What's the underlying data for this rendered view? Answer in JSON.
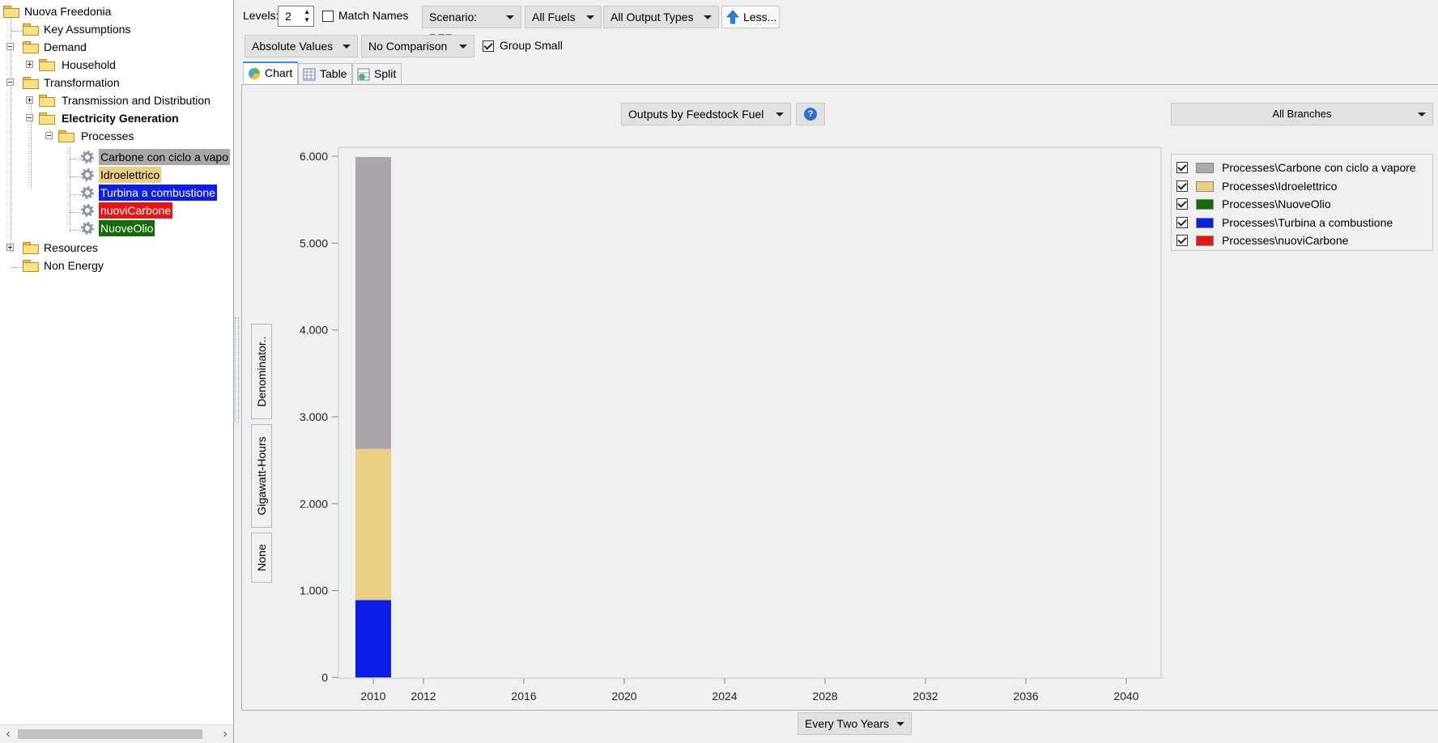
{
  "tree": {
    "root": "Nuova Freedonia",
    "key_assumptions": "Key Assumptions",
    "demand": "Demand",
    "household": "Household",
    "transformation": "Transformation",
    "transmission": "Transmission and Distribution",
    "electricity_generation": "Electricity Generation",
    "processes": "Processes",
    "process_items": [
      {
        "label": "Carbone con ciclo a vapo",
        "bg": "#a8a8a8",
        "fg": "#000000"
      },
      {
        "label": "Idroelettrico",
        "bg": "#e8cf83",
        "fg": "#000000"
      },
      {
        "label": "Turbina a combustione",
        "bg": "#0a1ee6",
        "fg": "#ffffff"
      },
      {
        "label": "nuoviCarbone",
        "bg": "#e61616",
        "fg": "#ffffff"
      },
      {
        "label": "NuoveOlio",
        "bg": "#166a0c",
        "fg": "#ffffff"
      }
    ],
    "resources": "Resources",
    "non_energy": "Non Energy"
  },
  "toolbar1": {
    "levels_label": "Levels:",
    "levels_value": "2",
    "match_names": "Match Names",
    "match_names_checked": false,
    "scenario": "Scenario: REF",
    "fuels": "All Fuels",
    "output_types": "All Output Types",
    "less": "Less..."
  },
  "toolbar2": {
    "values": "Absolute Values",
    "comparison": "No Comparison",
    "group_small": "Group Small",
    "group_small_checked": true
  },
  "tabs": [
    "Chart",
    "Table",
    "Split"
  ],
  "chart_header": {
    "outputs_by": "Outputs by Feedstock Fuel",
    "help_icon": "question-icon",
    "branches": "All Branches"
  },
  "side_tabs": [
    "Denominator..",
    "Gigawatt-Hours",
    "None"
  ],
  "bottom": {
    "interval": "Every Two Years"
  },
  "chart_data": {
    "type": "bar",
    "stacked": true,
    "x": [
      2010,
      2012,
      2016,
      2020,
      2024,
      2028,
      2032,
      2036,
      2040
    ],
    "x_tick_labels": [
      "2010",
      "2012",
      "2016",
      "2020",
      "2024",
      "2028",
      "2032",
      "2036",
      "2040"
    ],
    "y_tick_labels": [
      "0",
      "1.000",
      "2.000",
      "3.000",
      "4.000",
      "5.000",
      "6.000"
    ],
    "ylim": [
      0,
      6000
    ],
    "series": [
      {
        "name": "Processes\\Turbina a combustione",
        "color": "#0a1ee6",
        "values": [
          890,
          0,
          0,
          0,
          0,
          0,
          0,
          0,
          0
        ]
      },
      {
        "name": "Processes\\nuoviCarbone",
        "color": "#e61616",
        "values": [
          0,
          0,
          0,
          0,
          0,
          0,
          0,
          0,
          0
        ]
      },
      {
        "name": "Processes\\NuoveOlio",
        "color": "#166a0c",
        "values": [
          0,
          0,
          0,
          0,
          0,
          0,
          0,
          0,
          0
        ]
      },
      {
        "name": "Processes\\Idroelettrico",
        "color": "#e8cf83",
        "values": [
          1740,
          0,
          0,
          0,
          0,
          0,
          0,
          0,
          0
        ]
      },
      {
        "name": "Processes\\Carbone con ciclo a vapore",
        "color": "#aaa5aa",
        "values": [
          3360,
          0,
          0,
          0,
          0,
          0,
          0,
          0,
          0
        ]
      }
    ],
    "legend": [
      {
        "name": "Processes\\Carbone con ciclo a vapore",
        "color": "#aaaaaa",
        "checked": true
      },
      {
        "name": "Processes\\Idroelettrico",
        "color": "#e8cf83",
        "checked": true
      },
      {
        "name": "Processes\\NuoveOlio",
        "color": "#166a0c",
        "checked": true
      },
      {
        "name": "Processes\\Turbina a combustione",
        "color": "#0a1ee6",
        "checked": true
      },
      {
        "name": "Processes\\nuoviCarbone",
        "color": "#e61616",
        "checked": true
      }
    ],
    "legend_position": "right",
    "grid": false
  }
}
